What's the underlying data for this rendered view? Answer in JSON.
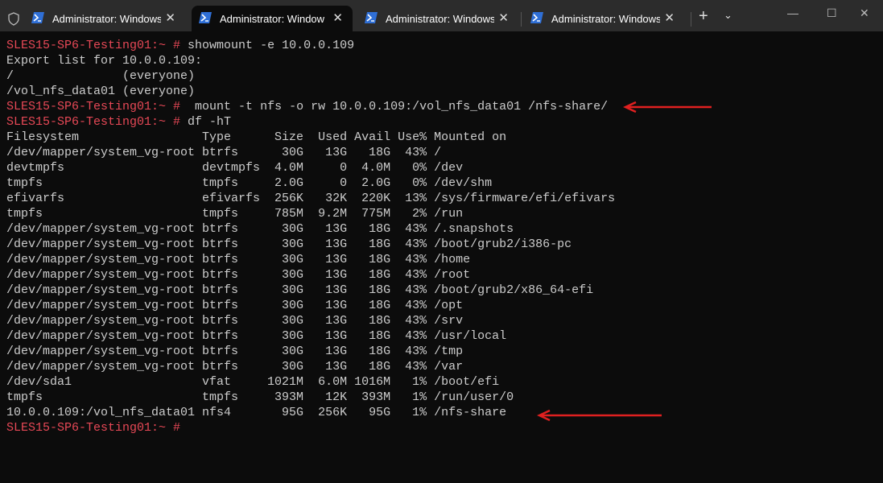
{
  "tabs": [
    {
      "label": "Administrator: Windows",
      "active": false
    },
    {
      "label": "Administrator: Window",
      "active": true
    },
    {
      "label": "Administrator: Windows",
      "active": false
    },
    {
      "label": "Administrator: Windows",
      "active": false
    }
  ],
  "tab_close": "✕",
  "new_tab": "+",
  "dropdown": "⌄",
  "window_controls": {
    "minimize": "—",
    "maximize": "☐",
    "close": "✕"
  },
  "terminal": {
    "prompt": "SLES15-SP6-Testing01:~ #",
    "cmd1": " showmount -e 10.0.0.109",
    "export_lines": [
      "Export list for 10.0.0.109:",
      "/               (everyone)",
      "/vol_nfs_data01 (everyone)"
    ],
    "cmd2": "  mount -t nfs -o rw 10.0.0.109:/vol_nfs_data01 /nfs-share/",
    "cmd3": " df -hT",
    "df_headers": [
      "Filesystem",
      "Type",
      "Size",
      "Used",
      "Avail",
      "Use%",
      "Mounted on"
    ],
    "df_rows": [
      [
        "/dev/mapper/system_vg-root",
        "btrfs",
        "30G",
        "13G",
        "18G",
        "43%",
        "/"
      ],
      [
        "devtmpfs",
        "devtmpfs",
        "4.0M",
        "0",
        "4.0M",
        "0%",
        "/dev"
      ],
      [
        "tmpfs",
        "tmpfs",
        "2.0G",
        "0",
        "2.0G",
        "0%",
        "/dev/shm"
      ],
      [
        "efivarfs",
        "efivarfs",
        "256K",
        "32K",
        "220K",
        "13%",
        "/sys/firmware/efi/efivars"
      ],
      [
        "tmpfs",
        "tmpfs",
        "785M",
        "9.2M",
        "775M",
        "2%",
        "/run"
      ],
      [
        "/dev/mapper/system_vg-root",
        "btrfs",
        "30G",
        "13G",
        "18G",
        "43%",
        "/.snapshots"
      ],
      [
        "/dev/mapper/system_vg-root",
        "btrfs",
        "30G",
        "13G",
        "18G",
        "43%",
        "/boot/grub2/i386-pc"
      ],
      [
        "/dev/mapper/system_vg-root",
        "btrfs",
        "30G",
        "13G",
        "18G",
        "43%",
        "/home"
      ],
      [
        "/dev/mapper/system_vg-root",
        "btrfs",
        "30G",
        "13G",
        "18G",
        "43%",
        "/root"
      ],
      [
        "/dev/mapper/system_vg-root",
        "btrfs",
        "30G",
        "13G",
        "18G",
        "43%",
        "/boot/grub2/x86_64-efi"
      ],
      [
        "/dev/mapper/system_vg-root",
        "btrfs",
        "30G",
        "13G",
        "18G",
        "43%",
        "/opt"
      ],
      [
        "/dev/mapper/system_vg-root",
        "btrfs",
        "30G",
        "13G",
        "18G",
        "43%",
        "/srv"
      ],
      [
        "/dev/mapper/system_vg-root",
        "btrfs",
        "30G",
        "13G",
        "18G",
        "43%",
        "/usr/local"
      ],
      [
        "/dev/mapper/system_vg-root",
        "btrfs",
        "30G",
        "13G",
        "18G",
        "43%",
        "/tmp"
      ],
      [
        "/dev/mapper/system_vg-root",
        "btrfs",
        "30G",
        "13G",
        "18G",
        "43%",
        "/var"
      ],
      [
        "/dev/sda1",
        "vfat",
        "1021M",
        "6.0M",
        "1016M",
        "1%",
        "/boot/efi"
      ],
      [
        "tmpfs",
        "tmpfs",
        "393M",
        "12K",
        "393M",
        "1%",
        "/run/user/0"
      ],
      [
        "10.0.0.109:/vol_nfs_data01",
        "nfs4",
        "95G",
        "256K",
        "95G",
        "1%",
        "/nfs-share"
      ]
    ]
  },
  "colors": {
    "prompt": "#e74856",
    "text": "#cccccc",
    "background": "#0c0c0c",
    "arrow": "#e02020"
  }
}
